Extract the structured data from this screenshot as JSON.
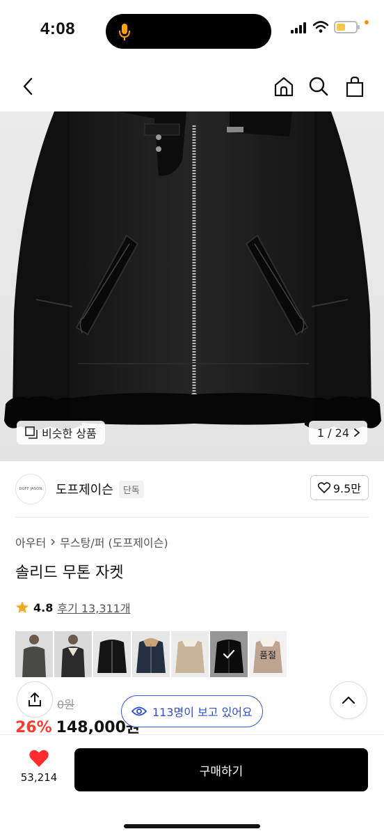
{
  "status": {
    "time": "4:08",
    "mic_icon": "microphone-icon",
    "signal_icon": "cellular-signal-icon",
    "wifi_icon": "wifi-icon",
    "battery_icon": "battery-low-icon",
    "battery_level": 0.45,
    "battery_color": "#f2c94c",
    "mic_color": "#ff9f0a"
  },
  "nav": {
    "back_icon": "chevron-left-icon",
    "home_icon": "home-icon",
    "search_icon": "search-icon",
    "bag_icon": "shopping-bag-icon"
  },
  "image": {
    "similar_label": "비슷한 상품",
    "similar_icon": "similar-items-icon",
    "page_indicator": "1 / 24"
  },
  "brand": {
    "logo_text": "DOFF JASON",
    "name": "도프제이슨",
    "badge": "단독",
    "likes": "9.5만"
  },
  "breadcrumb": {
    "category": "아우터",
    "subcategory": "무스탕/퍼 (도프제이슨)"
  },
  "product": {
    "title": "솔리드 무톤 자켓",
    "rating": "4.8",
    "reviews": "후기 13,311개",
    "original_price": "0원",
    "discount": "26%",
    "price": "148,000원"
  },
  "swatches": {
    "soldout_label": "품절",
    "items": [
      {
        "color": "#4a4a45",
        "selected": false
      },
      {
        "color": "#2b2b2b",
        "selected": false
      },
      {
        "color": "#151515",
        "selected": false
      },
      {
        "color": "#243042",
        "selected": false
      },
      {
        "color": "#c9b59a",
        "selected": false
      },
      {
        "color": "#111111",
        "selected": true
      },
      {
        "color": "#8a5a3a",
        "selected": false
      }
    ]
  },
  "viewers": "113명이 보고 있어요",
  "bottom": {
    "wish_count": "53,214",
    "buy_label": "구매하기"
  },
  "colors": {
    "accent_red": "#ff3b30",
    "accent_blue": "#3a5bd9",
    "buy_button": "#000000"
  }
}
